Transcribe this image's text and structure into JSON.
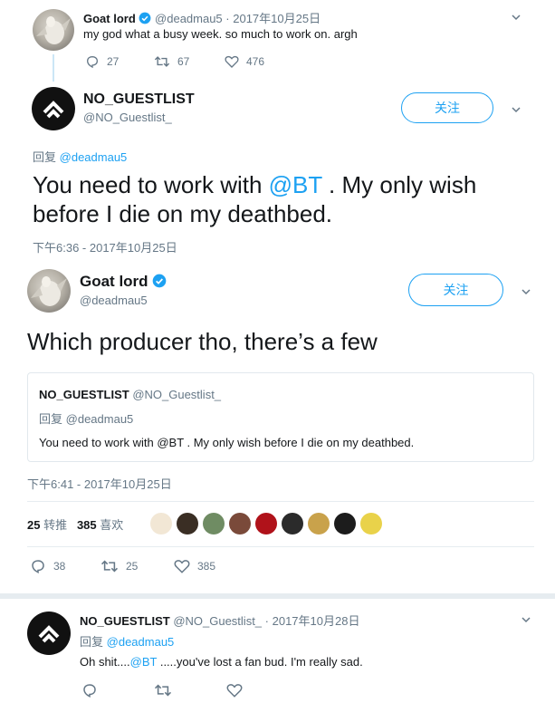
{
  "tweet1": {
    "name": "Goat lord",
    "handle": "@deadmau5",
    "date": "· 2017年10月25日",
    "text": "my god what a busy week. so much to work on. argh",
    "replies": "27",
    "retweets": "67",
    "likes": "476"
  },
  "tweet2": {
    "name": "NO_GUESTLIST",
    "handle": "@NO_Guestlist_",
    "follow": "关注",
    "reply_prefix": "回复",
    "reply_to": "@deadmau5",
    "text_a": "You need to work with ",
    "mention": "@BT",
    "text_b": " . My only wish",
    "text_c": "before I die on my deathbed.",
    "timestamp": "下午6:36 - 2017年10月25日"
  },
  "tweet3": {
    "name": "Goat lord",
    "handle": "@deadmau5",
    "follow": "关注",
    "text": "Which producer tho, there’s a few",
    "quote": {
      "name": "NO_GUESTLIST",
      "handle": "@NO_Guestlist_",
      "reply_prefix": "回复",
      "reply_to": "@deadmau5",
      "text": "You need to work with @BT . My only wish before I die on my deathbed."
    },
    "timestamp": "下午6:41 - 2017年10月25日",
    "retweet_count": "25",
    "retweet_label": "转推",
    "like_count": "385",
    "like_label": "喜欢",
    "replies": "38",
    "retweets": "25",
    "likes": "385"
  },
  "tweet4": {
    "name": "NO_GUESTLIST",
    "handle": "@NO_Guestlist_",
    "date": "· 2017年10月28日",
    "reply_prefix": "回复",
    "reply_to": "@deadmau5",
    "text_a": "Oh shit....",
    "mention": "@BT",
    "text_b": " .....you've lost a fan bud. I'm really sad."
  },
  "colors": {
    "accent": "#1da1f2",
    "text": "#14171a",
    "muted": "#657786"
  }
}
